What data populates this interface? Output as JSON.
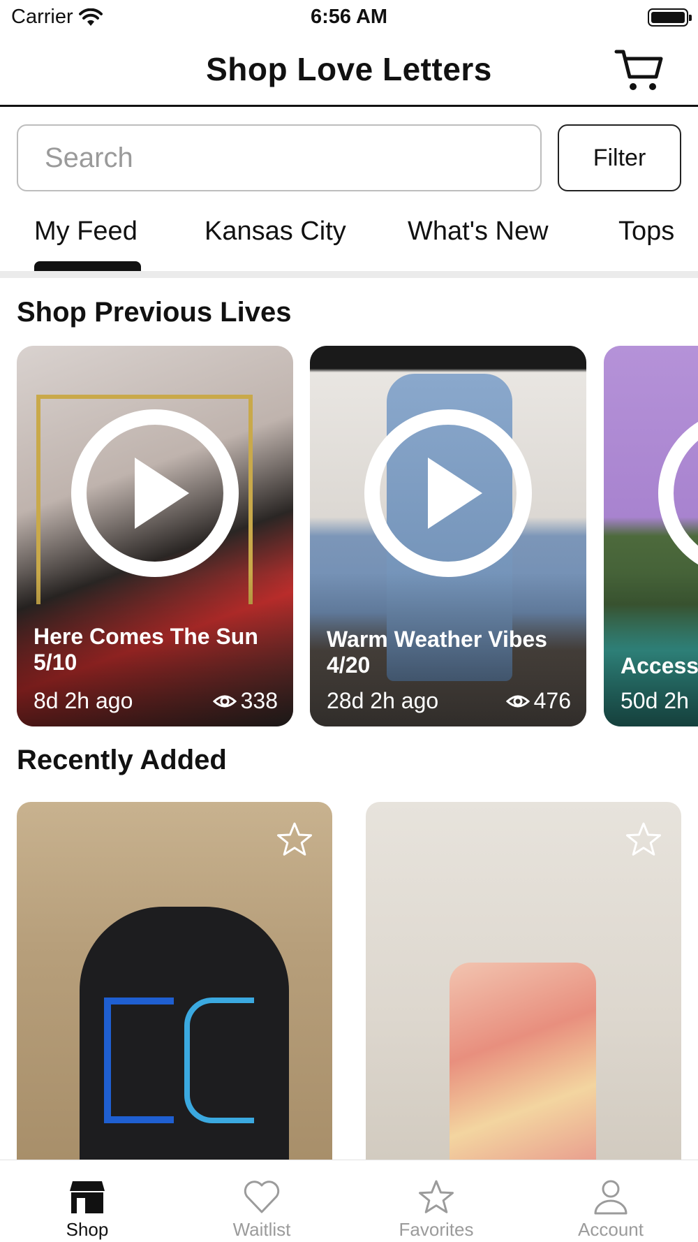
{
  "status_bar": {
    "carrier": "Carrier",
    "time": "6:56 AM"
  },
  "header": {
    "title": "Shop Love Letters",
    "cart_icon": "cart-icon"
  },
  "search": {
    "placeholder": "Search",
    "value": ""
  },
  "filter": {
    "label": "Filter"
  },
  "tabs": [
    {
      "label": "My Feed",
      "active": true
    },
    {
      "label": "Kansas City",
      "active": false
    },
    {
      "label": "What's New",
      "active": false
    },
    {
      "label": "Tops",
      "active": false
    }
  ],
  "previous_lives": {
    "title": "Shop Previous Lives",
    "items": [
      {
        "title": "Here Comes The Sun 5/10",
        "ago": "8d 2h ago",
        "views": "338"
      },
      {
        "title": "Warm Weather Vibes 4/20",
        "ago": "28d 2h ago",
        "views": "476"
      },
      {
        "title": "Access",
        "ago": "50d 2h"
      }
    ]
  },
  "recently_added": {
    "title": "Recently Added"
  },
  "tab_bar": [
    {
      "label": "Shop",
      "icon": "store-icon",
      "active": true
    },
    {
      "label": "Waitlist",
      "icon": "heart-icon",
      "active": false
    },
    {
      "label": "Favorites",
      "icon": "star-icon",
      "active": false
    },
    {
      "label": "Account",
      "icon": "person-icon",
      "active": false
    }
  ],
  "colors": {
    "accent": "#111111",
    "inactive": "#9b9b9b"
  }
}
